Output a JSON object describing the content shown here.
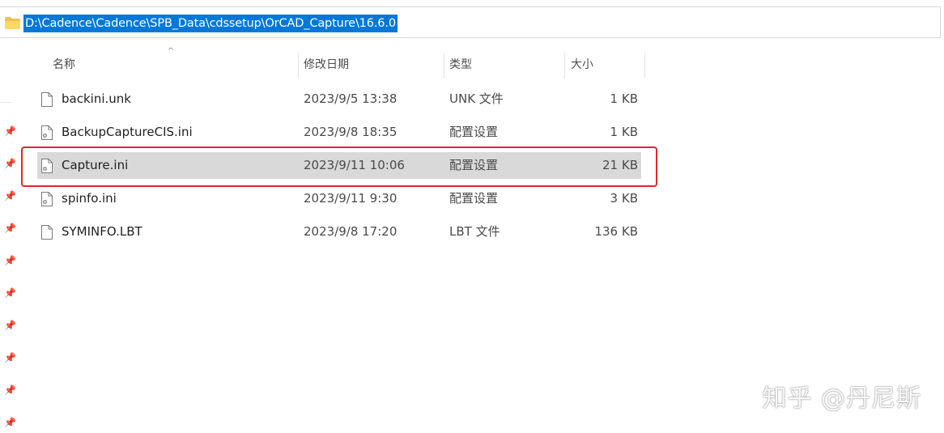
{
  "address_bar": {
    "path": "D:\\Cadence\\Cadence\\SPB_Data\\cdssetup\\OrCAD_Capture\\16.6.0"
  },
  "columns": {
    "name": "名称",
    "date_modified": "修改日期",
    "type": "类型",
    "size": "大小"
  },
  "files": [
    {
      "name": "backini.unk",
      "date": "2023/9/5 13:38",
      "type": "UNK 文件",
      "size": "1 KB",
      "icon": "blank-file-icon"
    },
    {
      "name": "BackupCaptureCIS.ini",
      "date": "2023/9/8 18:35",
      "type": "配置设置",
      "size": "1 KB",
      "icon": "settings-file-icon"
    },
    {
      "name": "Capture.ini",
      "date": "2023/9/11 10:06",
      "type": "配置设置",
      "size": "21 KB",
      "icon": "settings-file-icon",
      "selected": true
    },
    {
      "name": "spinfo.ini",
      "date": "2023/9/11 9:30",
      "type": "配置设置",
      "size": "3 KB",
      "icon": "settings-file-icon"
    },
    {
      "name": "SYMINFO.LBT",
      "date": "2023/9/8 17:20",
      "type": "LBT 文件",
      "size": "136 KB",
      "icon": "blank-file-icon"
    }
  ],
  "colors": {
    "selection_highlight": "#0078d7",
    "selected_row": "#d9d9d9",
    "annotation_box": "#e0262b"
  },
  "watermark": "知乎 @丹尼斯"
}
